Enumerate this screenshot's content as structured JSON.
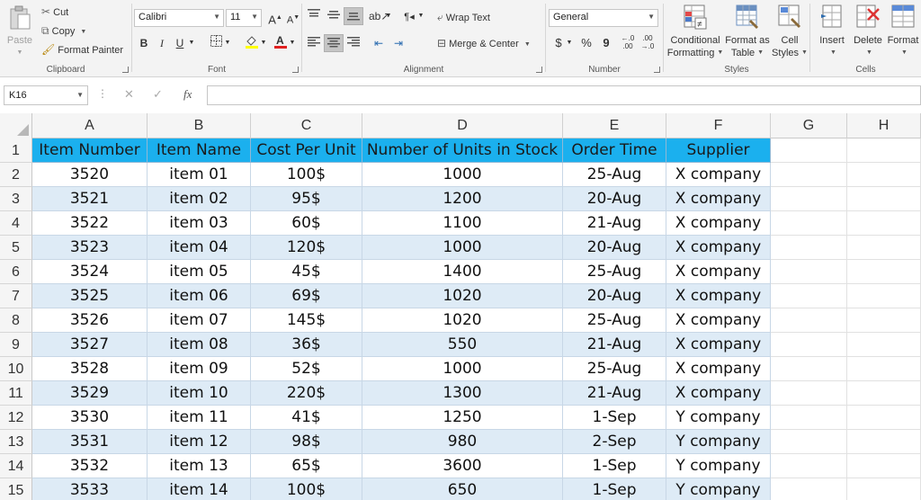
{
  "ribbon": {
    "clipboard": {
      "label": "Clipboard",
      "paste": "Paste",
      "cut": "Cut",
      "copy": "Copy",
      "format_painter": "Format Painter"
    },
    "font": {
      "label": "Font",
      "name": "Calibri",
      "size": "11",
      "grow": "A",
      "shrink": "A",
      "bold": "B",
      "italic": "I",
      "underline": "U"
    },
    "alignment": {
      "label": "Alignment",
      "wrap_text": "Wrap Text",
      "merge_center": "Merge & Center"
    },
    "number": {
      "label": "Number",
      "format": "General",
      "currency": "$",
      "percent": "%",
      "comma": "9"
    },
    "styles": {
      "label": "Styles",
      "conditional_formatting_line1": "Conditional",
      "conditional_formatting_line2": "Formatting",
      "format_as_table_line1": "Format as",
      "format_as_table_line2": "Table",
      "cell_styles_line1": "Cell",
      "cell_styles_line2": "Styles"
    },
    "cells": {
      "label": "Cells",
      "insert": "Insert",
      "delete": "Delete",
      "format": "Format"
    }
  },
  "formula_bar": {
    "name_box": "K16",
    "fx": "fx",
    "content": ""
  },
  "sheet": {
    "columns": [
      "A",
      "B",
      "C",
      "D",
      "E",
      "F",
      "G",
      "H"
    ],
    "rows": [
      {
        "num": "1",
        "cells": [
          "Item Number",
          "Item Name",
          "Cost Per Unit",
          "Number of Units in Stock",
          "Order Time",
          "Supplier"
        ]
      },
      {
        "num": "2",
        "cells": [
          "3520",
          "item 01",
          "100$",
          "1000",
          "25-Aug",
          "X company"
        ]
      },
      {
        "num": "3",
        "cells": [
          "3521",
          "item 02",
          "95$",
          "1200",
          "20-Aug",
          "X company"
        ]
      },
      {
        "num": "4",
        "cells": [
          "3522",
          "item 03",
          "60$",
          "1100",
          "21-Aug",
          "X company"
        ]
      },
      {
        "num": "5",
        "cells": [
          "3523",
          "item 04",
          "120$",
          "1000",
          "20-Aug",
          "X company"
        ]
      },
      {
        "num": "6",
        "cells": [
          "3524",
          "item 05",
          "45$",
          "1400",
          "25-Aug",
          "X company"
        ]
      },
      {
        "num": "7",
        "cells": [
          "3525",
          "item 06",
          "69$",
          "1020",
          "20-Aug",
          "X company"
        ]
      },
      {
        "num": "8",
        "cells": [
          "3526",
          "item 07",
          "145$",
          "1020",
          "25-Aug",
          "X company"
        ]
      },
      {
        "num": "9",
        "cells": [
          "3527",
          "item 08",
          "36$",
          "550",
          "21-Aug",
          "X company"
        ]
      },
      {
        "num": "10",
        "cells": [
          "3528",
          "item 09",
          "52$",
          "1000",
          "25-Aug",
          "X company"
        ]
      },
      {
        "num": "11",
        "cells": [
          "3529",
          "item 10",
          "220$",
          "1300",
          "21-Aug",
          "X company"
        ]
      },
      {
        "num": "12",
        "cells": [
          "3530",
          "item 11",
          "41$",
          "1250",
          "1-Sep",
          "Y company"
        ]
      },
      {
        "num": "13",
        "cells": [
          "3531",
          "item 12",
          "98$",
          "980",
          "2-Sep",
          "Y company"
        ]
      },
      {
        "num": "14",
        "cells": [
          "3532",
          "item 13",
          "65$",
          "3600",
          "1-Sep",
          "Y company"
        ]
      },
      {
        "num": "15",
        "cells": [
          "3533",
          "item 14",
          "100$",
          "650",
          "1-Sep",
          "Y company"
        ]
      }
    ]
  },
  "colors": {
    "header_fill": "#1bb0ee",
    "band_fill": "#deebf6"
  }
}
